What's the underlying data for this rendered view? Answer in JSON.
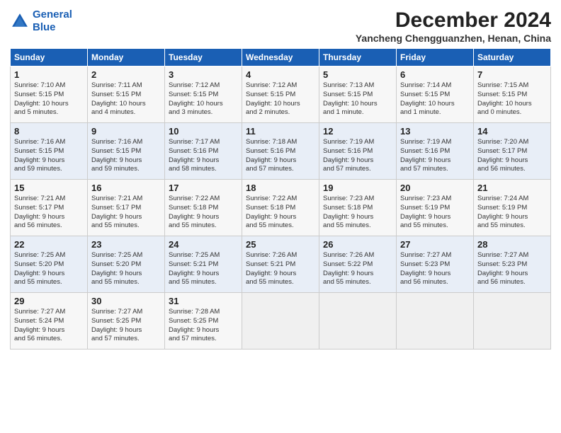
{
  "header": {
    "logo_line1": "General",
    "logo_line2": "Blue",
    "month": "December 2024",
    "location": "Yancheng Chengguanzhen, Henan, China"
  },
  "weekdays": [
    "Sunday",
    "Monday",
    "Tuesday",
    "Wednesday",
    "Thursday",
    "Friday",
    "Saturday"
  ],
  "weeks": [
    [
      {
        "day": "1",
        "lines": [
          "Sunrise: 7:10 AM",
          "Sunset: 5:15 PM",
          "Daylight: 10 hours",
          "and 5 minutes."
        ]
      },
      {
        "day": "2",
        "lines": [
          "Sunrise: 7:11 AM",
          "Sunset: 5:15 PM",
          "Daylight: 10 hours",
          "and 4 minutes."
        ]
      },
      {
        "day": "3",
        "lines": [
          "Sunrise: 7:12 AM",
          "Sunset: 5:15 PM",
          "Daylight: 10 hours",
          "and 3 minutes."
        ]
      },
      {
        "day": "4",
        "lines": [
          "Sunrise: 7:12 AM",
          "Sunset: 5:15 PM",
          "Daylight: 10 hours",
          "and 2 minutes."
        ]
      },
      {
        "day": "5",
        "lines": [
          "Sunrise: 7:13 AM",
          "Sunset: 5:15 PM",
          "Daylight: 10 hours",
          "and 1 minute."
        ]
      },
      {
        "day": "6",
        "lines": [
          "Sunrise: 7:14 AM",
          "Sunset: 5:15 PM",
          "Daylight: 10 hours",
          "and 1 minute."
        ]
      },
      {
        "day": "7",
        "lines": [
          "Sunrise: 7:15 AM",
          "Sunset: 5:15 PM",
          "Daylight: 10 hours",
          "and 0 minutes."
        ]
      }
    ],
    [
      {
        "day": "8",
        "lines": [
          "Sunrise: 7:16 AM",
          "Sunset: 5:15 PM",
          "Daylight: 9 hours",
          "and 59 minutes."
        ]
      },
      {
        "day": "9",
        "lines": [
          "Sunrise: 7:16 AM",
          "Sunset: 5:15 PM",
          "Daylight: 9 hours",
          "and 59 minutes."
        ]
      },
      {
        "day": "10",
        "lines": [
          "Sunrise: 7:17 AM",
          "Sunset: 5:16 PM",
          "Daylight: 9 hours",
          "and 58 minutes."
        ]
      },
      {
        "day": "11",
        "lines": [
          "Sunrise: 7:18 AM",
          "Sunset: 5:16 PM",
          "Daylight: 9 hours",
          "and 57 minutes."
        ]
      },
      {
        "day": "12",
        "lines": [
          "Sunrise: 7:19 AM",
          "Sunset: 5:16 PM",
          "Daylight: 9 hours",
          "and 57 minutes."
        ]
      },
      {
        "day": "13",
        "lines": [
          "Sunrise: 7:19 AM",
          "Sunset: 5:16 PM",
          "Daylight: 9 hours",
          "and 57 minutes."
        ]
      },
      {
        "day": "14",
        "lines": [
          "Sunrise: 7:20 AM",
          "Sunset: 5:17 PM",
          "Daylight: 9 hours",
          "and 56 minutes."
        ]
      }
    ],
    [
      {
        "day": "15",
        "lines": [
          "Sunrise: 7:21 AM",
          "Sunset: 5:17 PM",
          "Daylight: 9 hours",
          "and 56 minutes."
        ]
      },
      {
        "day": "16",
        "lines": [
          "Sunrise: 7:21 AM",
          "Sunset: 5:17 PM",
          "Daylight: 9 hours",
          "and 55 minutes."
        ]
      },
      {
        "day": "17",
        "lines": [
          "Sunrise: 7:22 AM",
          "Sunset: 5:18 PM",
          "Daylight: 9 hours",
          "and 55 minutes."
        ]
      },
      {
        "day": "18",
        "lines": [
          "Sunrise: 7:22 AM",
          "Sunset: 5:18 PM",
          "Daylight: 9 hours",
          "and 55 minutes."
        ]
      },
      {
        "day": "19",
        "lines": [
          "Sunrise: 7:23 AM",
          "Sunset: 5:18 PM",
          "Daylight: 9 hours",
          "and 55 minutes."
        ]
      },
      {
        "day": "20",
        "lines": [
          "Sunrise: 7:23 AM",
          "Sunset: 5:19 PM",
          "Daylight: 9 hours",
          "and 55 minutes."
        ]
      },
      {
        "day": "21",
        "lines": [
          "Sunrise: 7:24 AM",
          "Sunset: 5:19 PM",
          "Daylight: 9 hours",
          "and 55 minutes."
        ]
      }
    ],
    [
      {
        "day": "22",
        "lines": [
          "Sunrise: 7:25 AM",
          "Sunset: 5:20 PM",
          "Daylight: 9 hours",
          "and 55 minutes."
        ]
      },
      {
        "day": "23",
        "lines": [
          "Sunrise: 7:25 AM",
          "Sunset: 5:20 PM",
          "Daylight: 9 hours",
          "and 55 minutes."
        ]
      },
      {
        "day": "24",
        "lines": [
          "Sunrise: 7:25 AM",
          "Sunset: 5:21 PM",
          "Daylight: 9 hours",
          "and 55 minutes."
        ]
      },
      {
        "day": "25",
        "lines": [
          "Sunrise: 7:26 AM",
          "Sunset: 5:21 PM",
          "Daylight: 9 hours",
          "and 55 minutes."
        ]
      },
      {
        "day": "26",
        "lines": [
          "Sunrise: 7:26 AM",
          "Sunset: 5:22 PM",
          "Daylight: 9 hours",
          "and 55 minutes."
        ]
      },
      {
        "day": "27",
        "lines": [
          "Sunrise: 7:27 AM",
          "Sunset: 5:23 PM",
          "Daylight: 9 hours",
          "and 56 minutes."
        ]
      },
      {
        "day": "28",
        "lines": [
          "Sunrise: 7:27 AM",
          "Sunset: 5:23 PM",
          "Daylight: 9 hours",
          "and 56 minutes."
        ]
      }
    ],
    [
      {
        "day": "29",
        "lines": [
          "Sunrise: 7:27 AM",
          "Sunset: 5:24 PM",
          "Daylight: 9 hours",
          "and 56 minutes."
        ]
      },
      {
        "day": "30",
        "lines": [
          "Sunrise: 7:27 AM",
          "Sunset: 5:25 PM",
          "Daylight: 9 hours",
          "and 57 minutes."
        ]
      },
      {
        "day": "31",
        "lines": [
          "Sunrise: 7:28 AM",
          "Sunset: 5:25 PM",
          "Daylight: 9 hours",
          "and 57 minutes."
        ]
      },
      {
        "day": "",
        "lines": []
      },
      {
        "day": "",
        "lines": []
      },
      {
        "day": "",
        "lines": []
      },
      {
        "day": "",
        "lines": []
      }
    ]
  ]
}
